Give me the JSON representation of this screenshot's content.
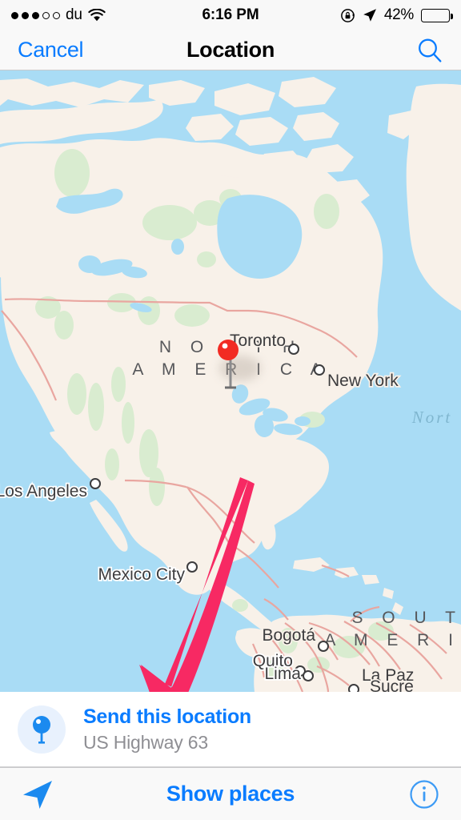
{
  "status_bar": {
    "signal_dots_filled": 3,
    "signal_dots_total": 5,
    "carrier": "du",
    "wifi_icon": "wifi-icon",
    "time": "6:16 PM",
    "rotation_lock_icon": "rotation-lock-icon",
    "location_arrow_icon": "location-arrow-icon",
    "battery_percent": "42%",
    "battery_level": 42
  },
  "nav_bar": {
    "cancel_label": "Cancel",
    "title": "Location",
    "search_icon": "search-icon"
  },
  "map": {
    "pin_icon": "map-pin-red",
    "continent_labels": [
      {
        "text": "NORTH AMERICA",
        "line1": "N O R T H",
        "line2": "A M E R I C A"
      },
      {
        "text": "SOUTH AMERICA",
        "line1": "S O U T H",
        "line2": "A M E R I C A"
      }
    ],
    "ocean_label": "Nort",
    "cities": [
      {
        "name": "Toronto"
      },
      {
        "name": "New York"
      },
      {
        "name": "Los Angeles"
      },
      {
        "name": "Mexico City"
      },
      {
        "name": "Bogotá"
      },
      {
        "name": "Quito"
      },
      {
        "name": "Lima"
      },
      {
        "name": "La Paz"
      },
      {
        "name": "Sucre"
      }
    ],
    "annotation": {
      "type": "arrow",
      "color": "#f72963",
      "points_to": "Send this location"
    },
    "colors": {
      "water": "#a9dcf5",
      "land": "#f8f1e9",
      "park": "#d9ecd0",
      "border": "#e9a6a0",
      "pin": "#f22b23"
    }
  },
  "send_row": {
    "icon": "location-pin-icon",
    "title": "Send this location",
    "subtitle": "US Highway 63"
  },
  "toolbar": {
    "locate_icon": "navigation-arrow-icon",
    "center_label": "Show places",
    "info_icon": "info-circle-icon"
  },
  "theme": {
    "accent_blue": "#0a7cff",
    "bar_background": "#f9f9f9",
    "subtitle_gray": "#8e8e93",
    "annotation_pink": "#f72963"
  }
}
